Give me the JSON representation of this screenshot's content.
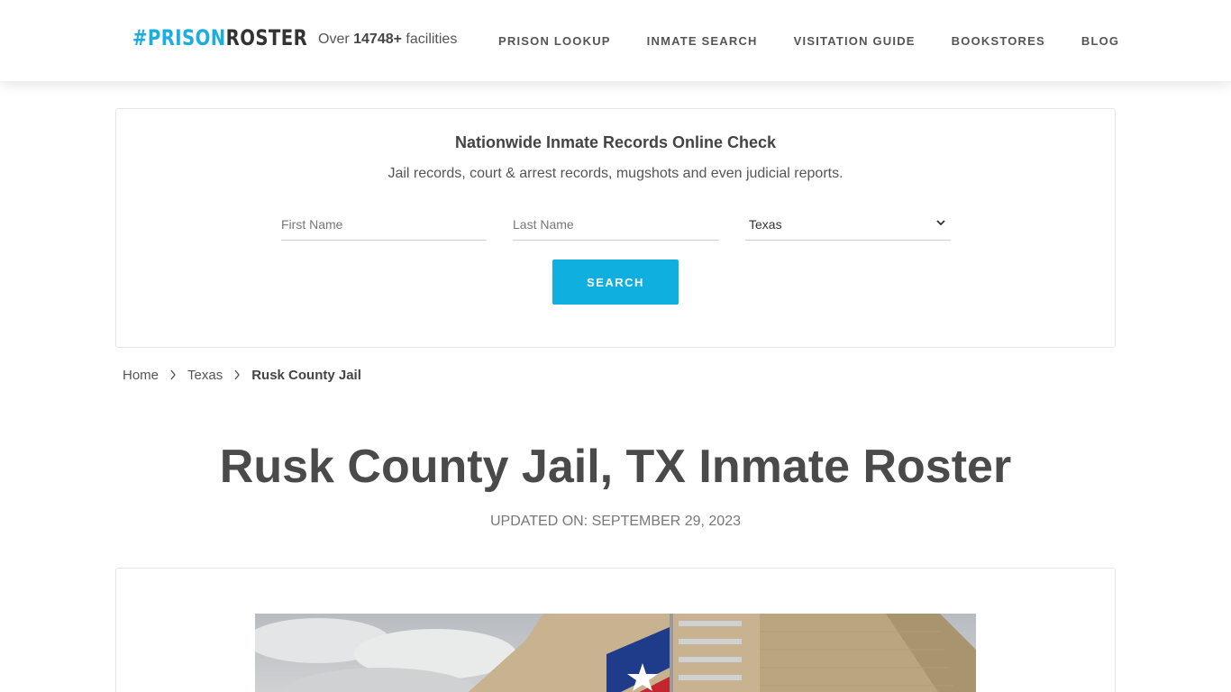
{
  "header": {
    "logo": {
      "hash": "#",
      "prison": "PRISON",
      "roster": "ROSTER"
    },
    "tagline": {
      "prefix": "Over ",
      "count": "14748+",
      "suffix": " facilities"
    },
    "nav": [
      {
        "label": "PRISON LOOKUP"
      },
      {
        "label": "INMATE SEARCH"
      },
      {
        "label": "VISITATION GUIDE"
      },
      {
        "label": "BOOKSTORES"
      },
      {
        "label": "BLOG"
      }
    ]
  },
  "search": {
    "title": "Nationwide Inmate Records Online Check",
    "subtitle": "Jail records, court & arrest records, mugshots and even judicial reports.",
    "first_name_placeholder": "First Name",
    "last_name_placeholder": "Last Name",
    "state_value": "Texas",
    "button_label": "SEARCH"
  },
  "breadcrumb": {
    "home": "Home",
    "state": "Texas",
    "current": "Rusk County Jail"
  },
  "page": {
    "title": "Rusk County Jail, TX Inmate Roster",
    "updated": "UPDATED ON: SEPTEMBER 29, 2023"
  },
  "colors": {
    "accent": "#0fb0e0",
    "text": "#444444"
  }
}
